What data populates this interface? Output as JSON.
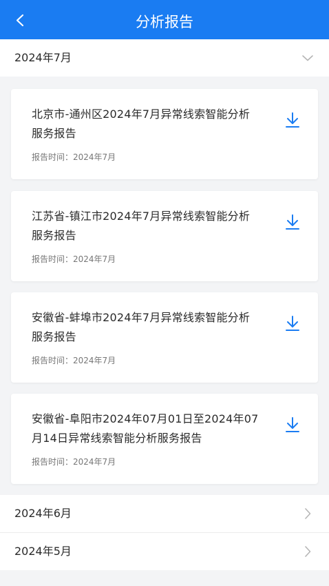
{
  "header": {
    "title": "分析报告"
  },
  "sections": [
    {
      "label": "2024年7月",
      "expanded": true
    },
    {
      "label": "2024年6月",
      "expanded": false
    },
    {
      "label": "2024年5月",
      "expanded": false
    }
  ],
  "reports": [
    {
      "title": "北京市-通州区2024年7月异常线索智能分析服务报告",
      "time": "报告时间：2024年7月"
    },
    {
      "title": "江苏省-镇江市2024年7月异常线索智能分析服务报告",
      "time": "报告时间：2024年7月"
    },
    {
      "title": "安徽省-蚌埠市2024年7月异常线索智能分析服务报告",
      "time": "报告时间：2024年7月"
    },
    {
      "title": "安徽省-阜阳市2024年07月01日至2024年07月14日异常线索智能分析服务报告",
      "time": "报告时间：2024年7月"
    }
  ],
  "colors": {
    "accent": "#1a7cf2",
    "background": "#f3f4f6"
  }
}
